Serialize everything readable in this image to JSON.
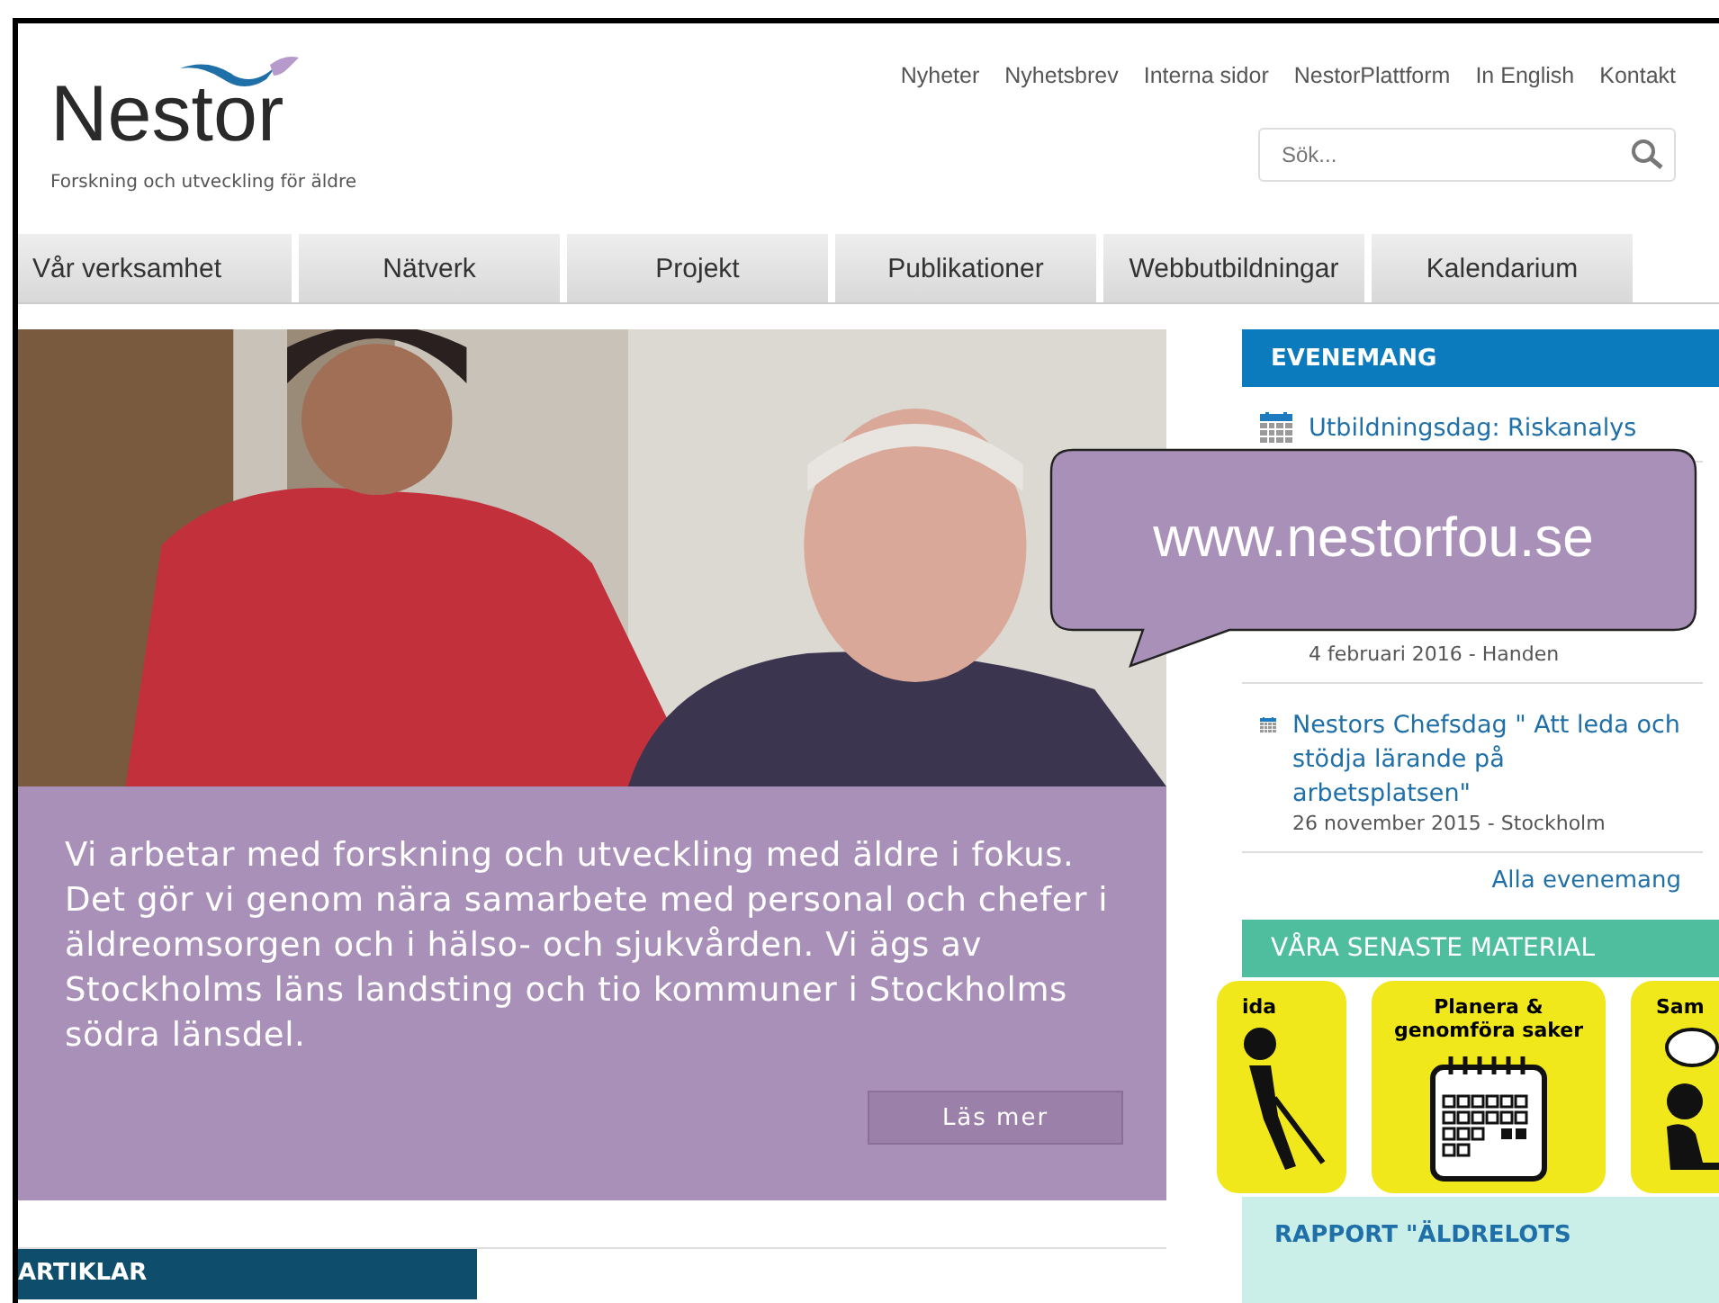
{
  "logo": {
    "name": "Nestor",
    "tagline": "Forskning och utveckling för äldre"
  },
  "top_links": [
    "Nyheter",
    "Nyhetsbrev",
    "Interna sidor",
    "NestorPlattform",
    "In English",
    "Kontakt"
  ],
  "search": {
    "placeholder": "Sök..."
  },
  "nav": [
    "Vår verksamhet",
    "Nätverk",
    "Projekt",
    "Publikationer",
    "Webbutbildningar",
    "Kalendarium"
  ],
  "hero": {
    "text": "Vi arbetar med forskning och utveckling med äldre i fokus. Det gör vi genom nära samarbete med personal och chefer i äldreomsorgen och i hälso- och sjukvården. Vi ägs av Stockholms läns landsting och tio kommuner i Stockholms södra länsdel.",
    "button": "Läs mer"
  },
  "articles": {
    "title": "ARTIKLAR"
  },
  "events": {
    "title": "EVENEMANG",
    "items": [
      {
        "title": "Utbildningsdag: Riskanalys"
      },
      {
        "dates": [
          "4 februari 2016 - Handen"
        ]
      },
      {
        "title": "Nestors Chefsdag \" Att leda och stödja lärande på arbetsplatsen\"",
        "dates": [
          "26 november 2015 - Stockholm"
        ]
      }
    ],
    "more": "Alla evenemang"
  },
  "materials": {
    "title": "VÅRA SENASTE MATERIAL",
    "tiles": [
      {
        "kind": "walker",
        "label": "ida"
      },
      {
        "kind": "calendar",
        "label": "Planera & genomföra saker"
      },
      {
        "kind": "talk",
        "label": "Sam"
      }
    ],
    "report": "RAPPORT \"ÄLDRELOTS"
  },
  "callout": {
    "text": "www.nestorfou.se"
  }
}
